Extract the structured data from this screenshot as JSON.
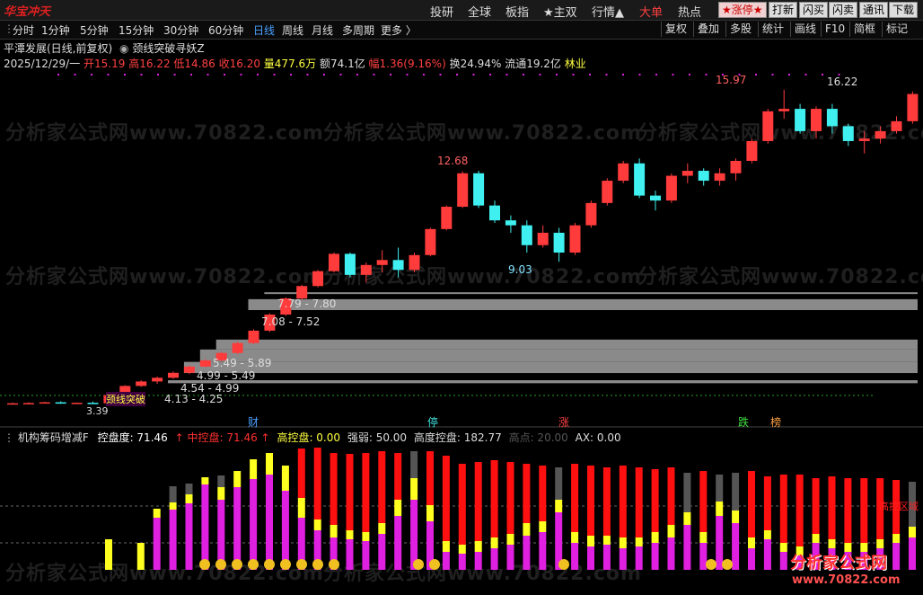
{
  "topbar": {
    "logo": "华宝冲天",
    "nav": [
      "投研",
      "全球",
      "板指",
      "★主双",
      "行情▲",
      "大单",
      "热点"
    ],
    "buttons": [
      "★涨停★",
      "打新",
      "闪买",
      "闪卖",
      "通讯",
      "下载"
    ]
  },
  "periods": [
    "分时",
    "1分钟",
    "5分钟",
    "15分钟",
    "30分钟",
    "60分钟",
    "日线",
    "周线",
    "月线",
    "多周期",
    "更多 〉"
  ],
  "active_period": "日线",
  "right_tools": [
    "复权",
    "叠加",
    "多股",
    "统计",
    "画线",
    "F10",
    "简框",
    "标记"
  ],
  "title": {
    "name": "平潭发展(日线,前复权)",
    "indicator": "颈线突破寻妖Z"
  },
  "info": {
    "date": "2025/12/29/一",
    "open": "开15.19",
    "high": "高16.22",
    "low": "低14.86",
    "close": "收16.20",
    "vol": "量477.6万",
    "amount": "额74.1亿",
    "change": "幅1.36(9.16%)",
    "turnover": "换24.94%",
    "float": "流通19.2亿",
    "industry": "林业"
  },
  "watermark": "分析家公式网www.70822.com",
  "price_labels": {
    "peak1": "12.68",
    "low1": "9.03",
    "peak2": "15.97",
    "last": "16.22",
    "start": "3.39"
  },
  "zones": [
    "7.79 - 7.80",
    "7.08 - 7.52",
    "5.49 - 5.89",
    "4.99 - 5.49",
    "4.54 - 4.99",
    "4.13 - 4.25"
  ],
  "neckline_label": "颈线突破",
  "markers": [
    {
      "text": "财",
      "color": "#4aa0ff"
    },
    {
      "text": "停",
      "color": "#40e0e0"
    },
    {
      "text": "涨",
      "color": "#ff4040"
    },
    {
      "text": "跌",
      "color": "#40e040"
    },
    {
      "text": "榜",
      "color": "#ffa040"
    }
  ],
  "indicator": {
    "name": "机构筹码增减F",
    "control": "控盘度: 71.46",
    "mid": "中控盘: 71.46",
    "high": "高控盘: 0.00",
    "strength": "强弱: 50.00",
    "high_degree": "高度控盘: 182.77",
    "peak": "高点: 20.00",
    "ax": "AX: 0.00",
    "zone_label": "高控区域"
  },
  "brand": {
    "line1": "分析家公式网",
    "line2": "www.70822.com"
  },
  "colors": {
    "up": "#ff3b3b",
    "down": "#40f0f0",
    "zone": "#8a8a8a",
    "purple": "#e020e0",
    "yellow": "#ffff20",
    "red": "#ff1010"
  },
  "chart_data": {
    "type": "candlestick",
    "ohlc": [
      [
        3.3,
        3.35,
        3.28,
        3.32
      ],
      [
        3.32,
        3.36,
        3.3,
        3.33
      ],
      [
        3.33,
        3.38,
        3.31,
        3.36
      ],
      [
        3.36,
        3.4,
        3.3,
        3.31
      ],
      [
        3.31,
        3.35,
        3.29,
        3.34
      ],
      [
        3.34,
        3.39,
        3.3,
        3.32
      ],
      [
        3.32,
        3.7,
        3.31,
        3.65
      ],
      [
        3.65,
        4.05,
        3.6,
        4.02
      ],
      [
        4.02,
        4.25,
        3.98,
        4.2
      ],
      [
        4.2,
        4.4,
        4.1,
        4.35
      ],
      [
        4.35,
        4.6,
        4.3,
        4.55
      ],
      [
        4.55,
        4.85,
        4.5,
        4.8
      ],
      [
        4.8,
        5.1,
        4.78,
        5.05
      ],
      [
        5.05,
        5.4,
        5.0,
        5.35
      ],
      [
        5.35,
        5.8,
        5.3,
        5.75
      ],
      [
        5.75,
        6.3,
        5.7,
        6.25
      ],
      [
        6.25,
        6.95,
        6.2,
        6.9
      ],
      [
        6.9,
        7.6,
        6.85,
        7.55
      ],
      [
        7.55,
        8.1,
        7.5,
        8.05
      ],
      [
        8.05,
        8.7,
        8.0,
        8.65
      ],
      [
        8.65,
        9.4,
        8.6,
        9.35
      ],
      [
        9.35,
        9.4,
        8.4,
        8.5
      ],
      [
        8.5,
        9.0,
        8.2,
        8.9
      ],
      [
        8.9,
        9.5,
        8.6,
        9.1
      ],
      [
        9.1,
        9.6,
        8.4,
        8.7
      ],
      [
        8.7,
        9.4,
        8.6,
        9.3
      ],
      [
        9.3,
        10.4,
        9.25,
        10.35
      ],
      [
        10.35,
        11.3,
        10.3,
        11.25
      ],
      [
        11.25,
        12.68,
        11.2,
        12.6
      ],
      [
        12.6,
        12.7,
        11.2,
        11.3
      ],
      [
        11.3,
        11.5,
        10.6,
        10.7
      ],
      [
        10.7,
        10.9,
        10.2,
        10.5
      ],
      [
        10.5,
        10.7,
        9.4,
        9.7
      ],
      [
        9.7,
        10.5,
        9.6,
        10.2
      ],
      [
        10.2,
        10.4,
        9.03,
        9.4
      ],
      [
        9.4,
        10.6,
        9.3,
        10.5
      ],
      [
        10.5,
        11.5,
        10.4,
        11.4
      ],
      [
        11.4,
        12.4,
        11.3,
        12.3
      ],
      [
        12.3,
        13.1,
        12.2,
        13.0
      ],
      [
        13.0,
        13.2,
        11.6,
        11.7
      ],
      [
        11.7,
        11.9,
        11.1,
        11.5
      ],
      [
        11.5,
        12.6,
        11.4,
        12.5
      ],
      [
        12.5,
        13.0,
        12.2,
        12.7
      ],
      [
        12.7,
        12.8,
        12.1,
        12.3
      ],
      [
        12.3,
        12.8,
        12.1,
        12.6
      ],
      [
        12.6,
        13.2,
        12.3,
        13.1
      ],
      [
        13.1,
        14.0,
        13.0,
        13.9
      ],
      [
        13.9,
        15.2,
        13.8,
        15.1
      ],
      [
        15.1,
        15.97,
        14.8,
        15.2
      ],
      [
        15.2,
        15.4,
        14.2,
        14.3
      ],
      [
        14.3,
        15.3,
        14.0,
        15.2
      ],
      [
        15.2,
        15.4,
        14.2,
        14.5
      ],
      [
        14.5,
        14.6,
        13.7,
        13.9
      ],
      [
        13.9,
        14.3,
        13.4,
        14.0
      ],
      [
        14.0,
        14.5,
        13.8,
        14.3
      ],
      [
        14.3,
        14.9,
        14.2,
        14.7
      ],
      [
        14.7,
        15.9,
        14.6,
        15.8
      ],
      [
        15.19,
        16.22,
        14.86,
        16.2
      ]
    ],
    "indicator_bars": [
      {
        "purple": 0,
        "yellow": 0,
        "red": 0,
        "base": 0
      },
      {
        "purple": 0,
        "yellow": 0,
        "red": 0,
        "base": 0
      },
      {
        "purple": 0,
        "yellow": 0,
        "red": 0,
        "base": 0
      },
      {
        "purple": 0,
        "yellow": 0,
        "red": 0,
        "base": 0
      },
      {
        "purple": 0,
        "yellow": 0,
        "red": 0,
        "base": 0
      },
      {
        "purple": 0,
        "yellow": 0,
        "red": 0,
        "base": 0
      },
      {
        "purple": 0,
        "yellow": 34,
        "red": 0,
        "base": 1
      },
      {
        "purple": 0,
        "yellow": 0,
        "red": 0,
        "base": 0
      },
      {
        "purple": 0,
        "yellow": 30,
        "red": 0,
        "base": 1
      },
      {
        "purple": 58,
        "yellow": 10,
        "red": 0,
        "base": 0
      },
      {
        "purple": 67,
        "yellow": 8,
        "red": 18,
        "base": 0
      },
      {
        "purple": 74,
        "yellow": 10,
        "red": 12,
        "base": 0
      },
      {
        "purple": 95,
        "yellow": 8,
        "red": 0,
        "base": 0
      },
      {
        "purple": 78,
        "yellow": 14,
        "red": 13,
        "base": 0
      },
      {
        "purple": 92,
        "yellow": 18,
        "red": 0,
        "base": 0
      },
      {
        "purple": 101,
        "yellow": 22,
        "red": 0,
        "base": 0
      },
      {
        "purple": 106,
        "yellow": 24,
        "red": 0,
        "base": 0
      },
      {
        "purple": 88,
        "yellow": 28,
        "red": 0,
        "base": 0
      },
      {
        "purple": 58,
        "yellow": 22,
        "red": 55,
        "base": 0
      },
      {
        "purple": 44,
        "yellow": 12,
        "red": 80,
        "base": 0
      },
      {
        "purple": 36,
        "yellow": 14,
        "red": 80,
        "base": 0
      },
      {
        "purple": 34,
        "yellow": 10,
        "red": 85,
        "base": 0
      },
      {
        "purple": 32,
        "yellow": 10,
        "red": 88,
        "base": 0
      },
      {
        "purple": 40,
        "yellow": 12,
        "red": 80,
        "base": 0
      },
      {
        "purple": 60,
        "yellow": 18,
        "red": 52,
        "base": 0
      },
      {
        "purple": 78,
        "yellow": 24,
        "red": 30,
        "base": 0
      },
      {
        "purple": 54,
        "yellow": 18,
        "red": 60,
        "base": 0
      },
      {
        "purple": 20,
        "yellow": 12,
        "red": 95,
        "base": 0
      },
      {
        "purple": 18,
        "yellow": 10,
        "red": 90,
        "base": 0
      },
      {
        "purple": 20,
        "yellow": 12,
        "red": 88,
        "base": 0
      },
      {
        "purple": 24,
        "yellow": 12,
        "red": 86,
        "base": 0
      },
      {
        "purple": 28,
        "yellow": 12,
        "red": 80,
        "base": 0
      },
      {
        "purple": 38,
        "yellow": 14,
        "red": 66,
        "base": 0
      },
      {
        "purple": 42,
        "yellow": 12,
        "red": 62,
        "base": 0
      },
      {
        "purple": 64,
        "yellow": 14,
        "red": 36,
        "base": 0
      },
      {
        "purple": 30,
        "yellow": 12,
        "red": 76,
        "base": 0
      },
      {
        "purple": 26,
        "yellow": 12,
        "red": 78,
        "base": 0
      },
      {
        "purple": 28,
        "yellow": 10,
        "red": 76,
        "base": 0
      },
      {
        "purple": 24,
        "yellow": 12,
        "red": 80,
        "base": 0
      },
      {
        "purple": 26,
        "yellow": 10,
        "red": 78,
        "base": 0
      },
      {
        "purple": 30,
        "yellow": 12,
        "red": 70,
        "base": 0
      },
      {
        "purple": 36,
        "yellow": 14,
        "red": 64,
        "base": 0
      },
      {
        "purple": 50,
        "yellow": 14,
        "red": 44,
        "base": 0
      },
      {
        "purple": 30,
        "yellow": 12,
        "red": 68,
        "base": 0
      },
      {
        "purple": 60,
        "yellow": 16,
        "red": 30,
        "base": 0
      },
      {
        "purple": 52,
        "yellow": 14,
        "red": 42,
        "base": 0
      },
      {
        "purple": 24,
        "yellow": 12,
        "red": 74,
        "base": 0
      },
      {
        "purple": 34,
        "yellow": 10,
        "red": 60,
        "base": 0
      },
      {
        "purple": 20,
        "yellow": 10,
        "red": 76,
        "base": 0
      },
      {
        "purple": 16,
        "yellow": 10,
        "red": 80,
        "base": 0
      },
      {
        "purple": 30,
        "yellow": 10,
        "red": 62,
        "base": 0
      },
      {
        "purple": 24,
        "yellow": 10,
        "red": 70,
        "base": 0
      },
      {
        "purple": 20,
        "yellow": 10,
        "red": 72,
        "base": 0
      },
      {
        "purple": 20,
        "yellow": 10,
        "red": 72,
        "base": 0
      },
      {
        "purple": 24,
        "yellow": 10,
        "red": 68,
        "base": 0
      },
      {
        "purple": 30,
        "yellow": 10,
        "red": 60,
        "base": 0
      },
      {
        "purple": 36,
        "yellow": 12,
        "red": 50,
        "base": 0
      },
      {
        "purple": 44,
        "yellow": 12,
        "red": 36,
        "base": 0
      }
    ]
  }
}
